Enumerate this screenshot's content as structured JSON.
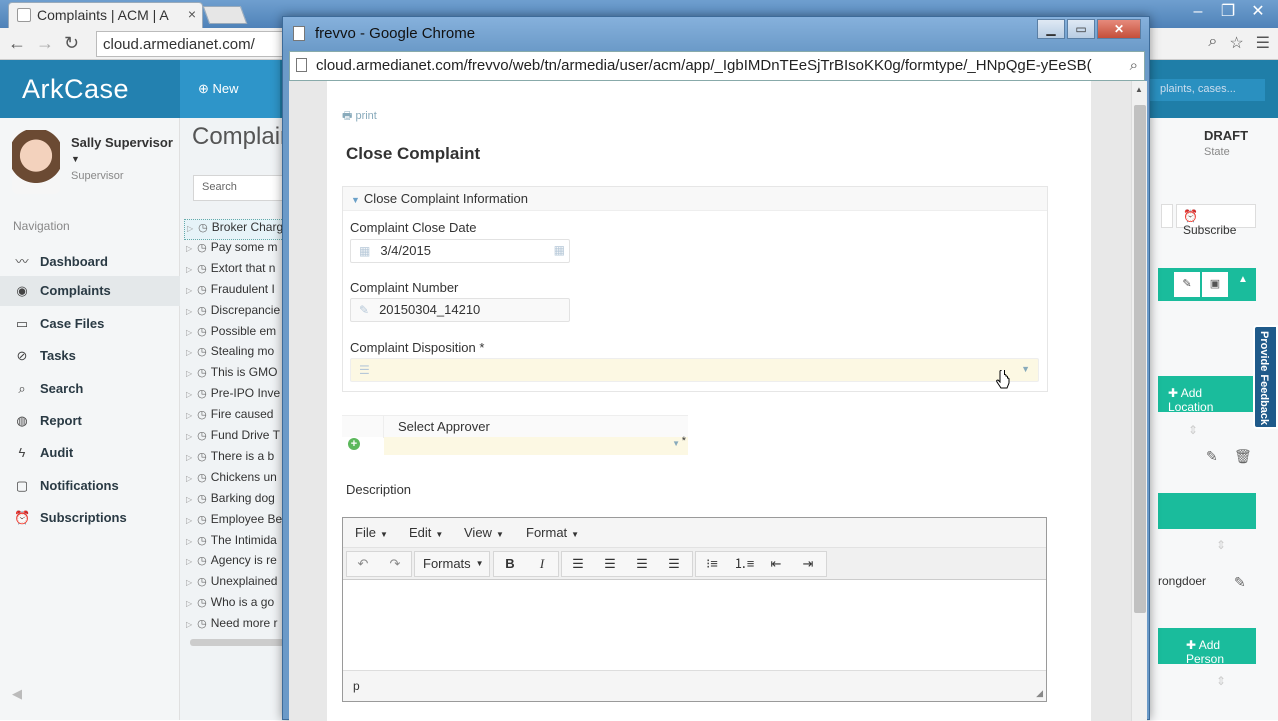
{
  "background_browser": {
    "tab_title": "Complaints | ACM | A",
    "url": "cloud.armedianet.com/",
    "app": {
      "logo": "ArkCase",
      "new_button": "New",
      "search_hint": "plaints, cases...",
      "user": {
        "name": "Sally Supervisor",
        "role": "Supervisor"
      },
      "nav_heading": "Navigation",
      "nav_items": [
        {
          "label": "Dashboard",
          "icon": "chart-line-icon"
        },
        {
          "label": "Complaints",
          "icon": "complaints-icon"
        },
        {
          "label": "Case Files",
          "icon": "folder-icon"
        },
        {
          "label": "Tasks",
          "icon": "check-circle-icon"
        },
        {
          "label": "Search",
          "icon": "search-icon"
        },
        {
          "label": "Report",
          "icon": "globe-icon"
        },
        {
          "label": "Audit",
          "icon": "bolt-icon"
        },
        {
          "label": "Notifications",
          "icon": "chat-icon"
        },
        {
          "label": "Subscriptions",
          "icon": "alarm-icon"
        }
      ],
      "page_title": "Complain",
      "search_placeholder": "Search",
      "complaint_list": [
        "Broker Charg",
        "Pay some m",
        "Extort that n",
        "Fraudulent I",
        "Discrepancie",
        "Possible em",
        "Stealing mo",
        "This is GMO",
        "Pre-IPO Inve",
        "Fire caused",
        "Fund Drive T",
        "There is a b",
        "Chickens un",
        "Barking dog",
        "Employee Be",
        "The Intimida",
        "Agency is re",
        "Unexplained",
        "Who is a go",
        "Need more r"
      ],
      "right_panel": {
        "status": "DRAFT",
        "status_label": "State",
        "subscribe": "Subscribe",
        "add_location": "Add Location",
        "wrongdoer_text": "rongdoer",
        "add_person": "Add Person",
        "feedback": "Provide Feedback"
      }
    }
  },
  "popup": {
    "window_title": "frevvo - Google Chrome",
    "url": "cloud.armedianet.com/frevvo/web/tn/armedia/user/acm/app/_IgbIMDnTEeSjTrBIsoKK0g/formtype/_HNpQgE-yEeSB(",
    "form": {
      "print_label": "print",
      "title": "Close Complaint",
      "section_title": "Close Complaint Information",
      "close_date_label": "Complaint Close Date",
      "close_date_value": "3/4/2015",
      "number_label": "Complaint Number",
      "number_value": "20150304_14210",
      "disposition_label": "Complaint Disposition *",
      "disposition_value": "",
      "approver_label": "Select Approver",
      "approver_value": "",
      "description_label": "Description",
      "editor": {
        "menus": [
          "File",
          "Edit",
          "View",
          "Format"
        ],
        "formats_label": "Formats",
        "status_path": "p",
        "content": ""
      }
    }
  }
}
